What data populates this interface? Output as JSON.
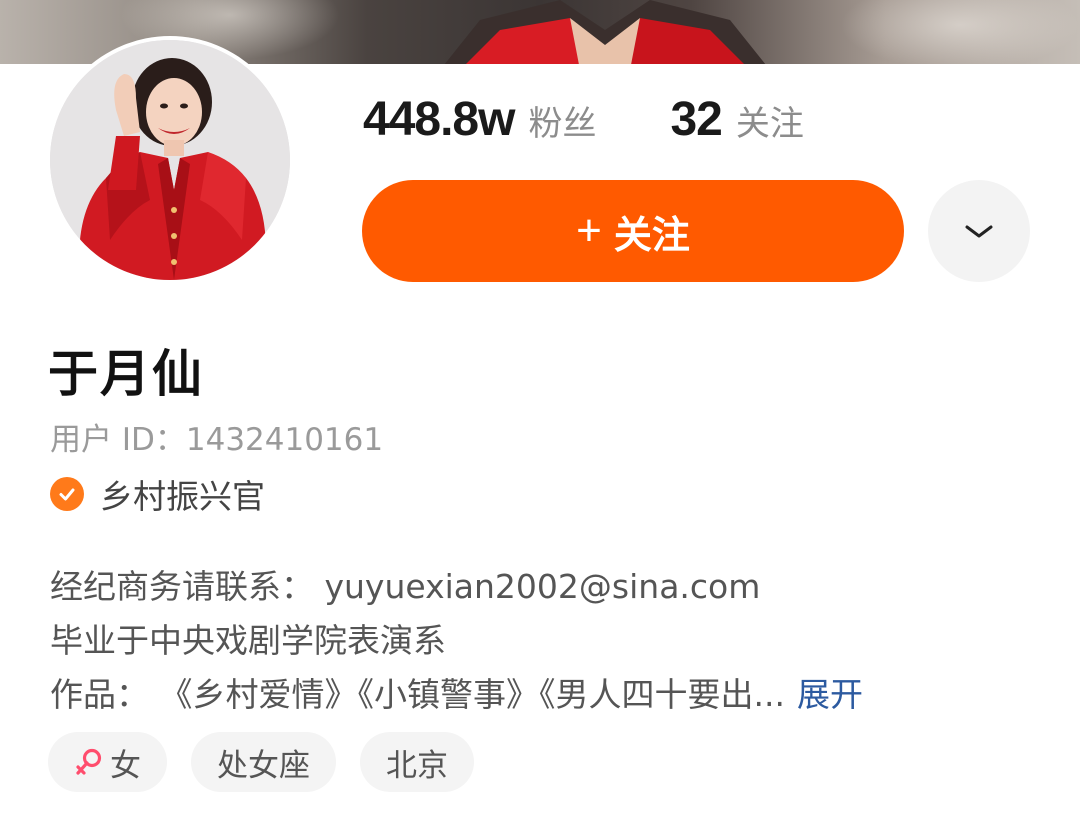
{
  "stats": {
    "followers_count": "448.8w",
    "followers_label": "粉丝",
    "following_count": "32",
    "following_label": "关注"
  },
  "actions": {
    "follow_plus": "+",
    "follow_label": "关注",
    "more_icon": "chevron-down-icon"
  },
  "profile": {
    "name": "于月仙",
    "user_id": "用户 ID：1432410161",
    "verified_icon": "verified-check-icon",
    "verified_title": "乡村振兴官"
  },
  "bio": {
    "line1": "经纪商务请联系： yuyuexian2002@sina.com",
    "line2": "毕业于中央戏剧学院表演系",
    "line3": "作品： 《乡村爱情》《小镇警事》《男人四十要出...",
    "expand_label": "展开"
  },
  "tags": [
    {
      "icon": "female-icon",
      "label": "女"
    },
    {
      "label": "处女座"
    },
    {
      "label": "北京"
    }
  ],
  "colors": {
    "accent": "#ff5a00",
    "verified": "#ff7a1a",
    "link": "#2c5aa0",
    "female": "#ff4d6d"
  }
}
